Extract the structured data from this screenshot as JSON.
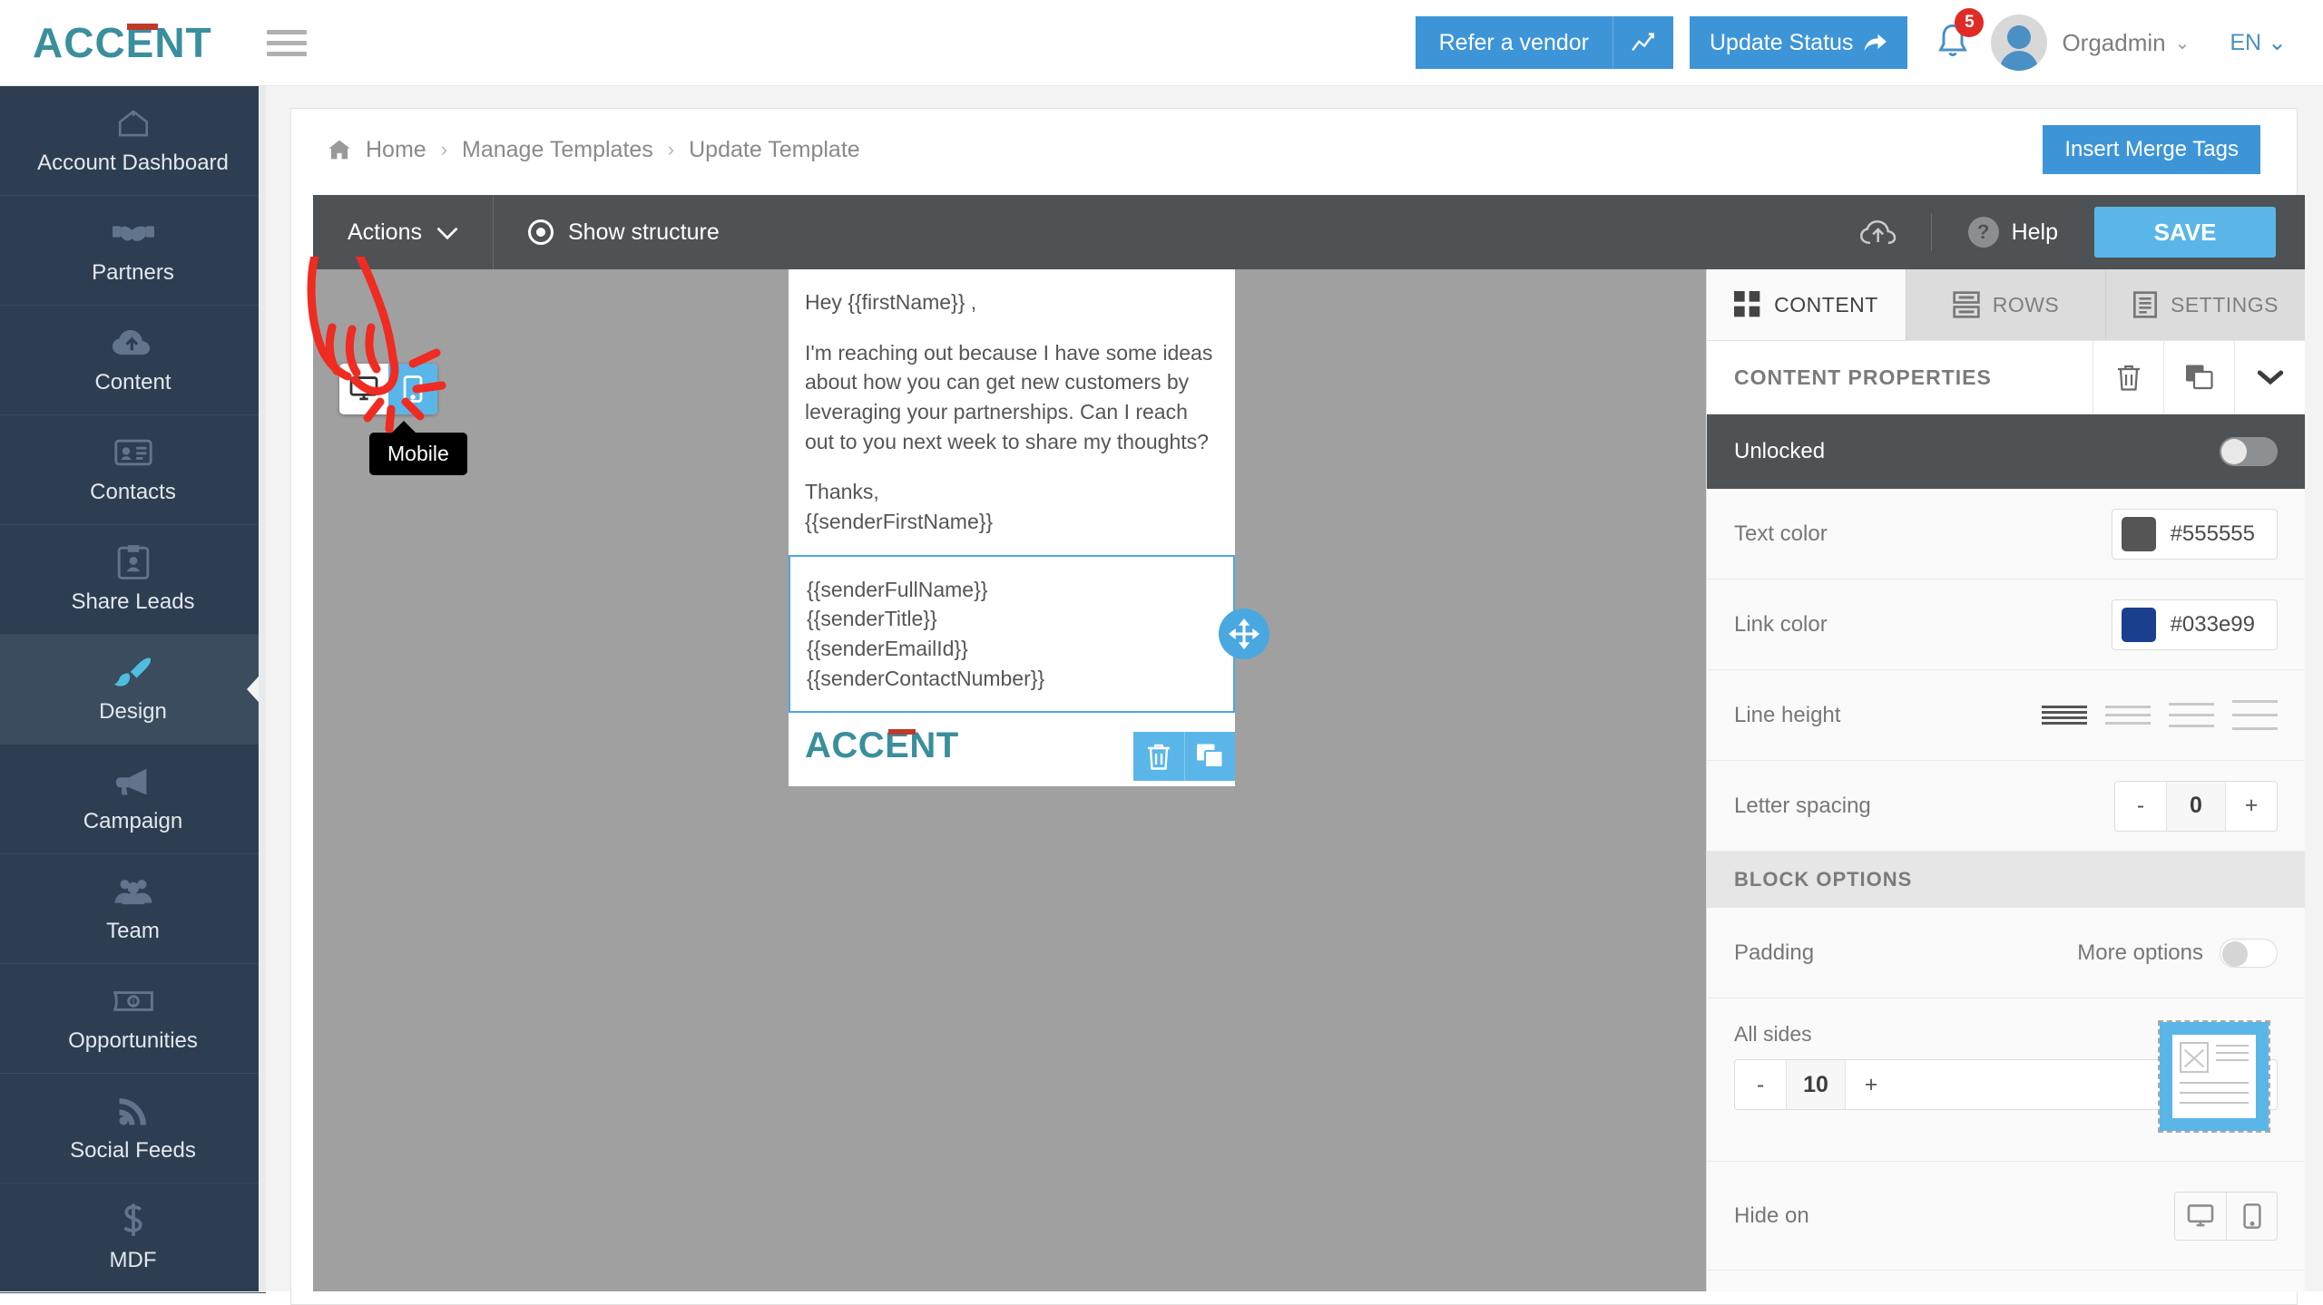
{
  "brand": {
    "name": "ACCENT",
    "logo_color": "#3a8f9c",
    "accent_mark_color": "#c0392b"
  },
  "header": {
    "menu_icon": "hamburger-icon",
    "refer_button": "Refer a vendor",
    "chart_icon": "chart-line-icon",
    "update_status_button": "Update Status",
    "share_icon": "share-arrow-icon",
    "notification_icon": "bell-icon",
    "notification_count": "5",
    "user_name": "Orgadmin",
    "user_caret": "⌄",
    "language": "EN",
    "language_caret": "⌄",
    "accent_blue": "#3d95d8"
  },
  "sidebar": {
    "items": [
      {
        "label": "Account Dashboard",
        "icon": "home-icon",
        "active": false
      },
      {
        "label": "Partners",
        "icon": "handshake-icon",
        "active": false
      },
      {
        "label": "Content",
        "icon": "cloud-upload-icon",
        "active": false
      },
      {
        "label": "Contacts",
        "icon": "contact-card-icon",
        "active": false
      },
      {
        "label": "Share Leads",
        "icon": "id-badge-icon",
        "active": false
      },
      {
        "label": "Design",
        "icon": "paint-brush-icon",
        "active": true
      },
      {
        "label": "Campaign",
        "icon": "megaphone-icon",
        "active": false
      },
      {
        "label": "Team",
        "icon": "users-icon",
        "active": false
      },
      {
        "label": "Opportunities",
        "icon": "money-bill-icon",
        "active": false
      },
      {
        "label": "Social Feeds",
        "icon": "rss-icon",
        "active": false
      },
      {
        "label": "MDF",
        "icon": "dollar-sign-icon",
        "active": false
      }
    ]
  },
  "breadcrumb": {
    "home_icon": "home-icon",
    "items": [
      "Home",
      "Manage Templates",
      "Update Template"
    ],
    "separator": "›",
    "insert_merge_tags_button": "Insert Merge Tags"
  },
  "editor_toolbar": {
    "actions_label": "Actions",
    "actions_caret": "⌄",
    "show_structure_label": "Show structure",
    "show_structure_icon": "eye-target-icon",
    "cloud_icon": "cloud-upload-icon",
    "help_label": "Help",
    "help_icon": "question-circle-icon",
    "save_button": "SAVE",
    "save_color": "#5ab6e8",
    "toolbar_bg": "#4e5254"
  },
  "device_toggle": {
    "desktop_icon": "desktop-icon",
    "mobile_icon": "mobile-icon",
    "selected": "mobile",
    "tooltip": "Mobile"
  },
  "annotation": {
    "type": "hand-cursor-click-annotation",
    "color": "#ef2b22",
    "points_at": "mobile-device-toggle"
  },
  "email": {
    "body_lines": [
      "Hey {{firstName}} ,",
      "",
      "I'm reaching out because I have some ideas about how you can get new customers by leveraging your partnerships. Can I reach out to you next week to share my thoughts?",
      "",
      "Thanks,",
      "{{senderFirstName}}"
    ],
    "signature_lines": [
      "{{senderFullName}}",
      "{{senderTitle}}",
      "{{senderEmailId}}",
      "{{senderContactNumber}}"
    ],
    "logo_text": "ACCENT",
    "move_handle_icon": "move-arrows-icon",
    "delete_icon": "trash-icon",
    "duplicate_icon": "copy-icon",
    "selection_color": "#4aa8e0"
  },
  "right_panel": {
    "tabs": [
      {
        "label": "CONTENT",
        "icon": "grid-squares-icon",
        "active": true
      },
      {
        "label": "ROWS",
        "icon": "rows-icon",
        "active": false
      },
      {
        "label": "SETTINGS",
        "icon": "document-lines-icon",
        "active": false
      }
    ],
    "properties_title": "CONTENT PROPERTIES",
    "header_actions": [
      {
        "icon": "trash-icon",
        "name": "delete"
      },
      {
        "icon": "copy-icon",
        "name": "duplicate"
      },
      {
        "icon": "chevron-down-icon",
        "name": "collapse"
      }
    ],
    "unlocked_label": "Unlocked",
    "unlocked_on": false,
    "text_color_label": "Text color",
    "text_color_value": "#555555",
    "link_color_label": "Link color",
    "link_color_value": "#033e99",
    "line_height_label": "Line height",
    "line_height_selected": 0,
    "letter_spacing_label": "Letter spacing",
    "letter_spacing_value": "0",
    "minus": "-",
    "plus": "+",
    "block_options_title": "BLOCK OPTIONS",
    "padding_label": "Padding",
    "more_options_label": "More options",
    "more_options_on": false,
    "all_sides_label": "All sides",
    "all_sides_value": "10",
    "hide_on_label": "Hide on",
    "hide_on_desktop_icon": "desktop-icon",
    "hide_on_mobile_icon": "mobile-icon"
  }
}
